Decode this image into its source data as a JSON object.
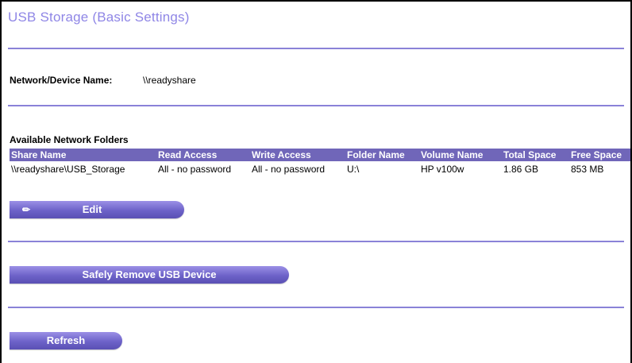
{
  "page": {
    "title": "USB Storage (Basic Settings)"
  },
  "device": {
    "label": "Network/Device Name:",
    "value": "\\\\readyshare"
  },
  "folders": {
    "heading": "Available Network Folders",
    "columns": [
      "Share Name",
      "Read Access",
      "Write Access",
      "Folder Name",
      "Volume Name",
      "Total Space",
      "Free Space"
    ],
    "rows": [
      {
        "share_name": "\\\\readyshare\\USB_Storage",
        "read_access": "All - no password",
        "write_access": "All - no password",
        "folder_name": "U:\\",
        "volume_name": "HP v100w",
        "total_space": "1.86 GB",
        "free_space": "853 MB"
      }
    ]
  },
  "buttons": {
    "edit": "Edit",
    "edit_icon": "pencil-icon",
    "safely_remove": "Safely Remove USB Device",
    "refresh": "Refresh"
  },
  "colors": {
    "title": "#8f86e6",
    "accent": "#7066b9",
    "divider": "#8a82d8"
  }
}
